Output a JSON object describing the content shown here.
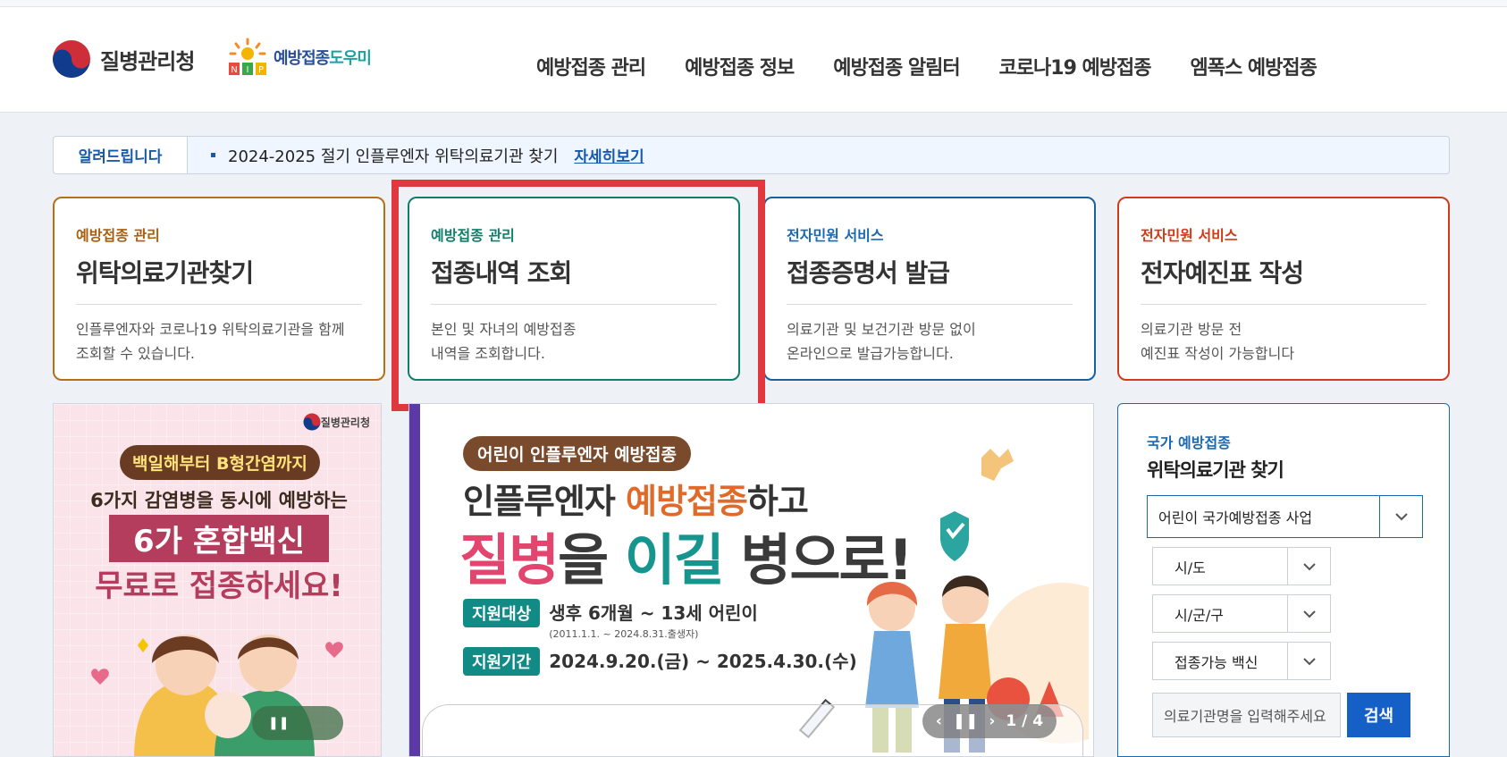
{
  "header": {
    "org_name": "질병관리청",
    "nip_logo_text_a": "예방접종",
    "nip_logo_text_b": "도우미",
    "nav": [
      "예방접종 관리",
      "예방접종 정보",
      "예방접종 알림터",
      "코로나19 예방접종",
      "엠폭스 예방접종"
    ]
  },
  "notice": {
    "tag": "알려드립니다",
    "message": "2024-2025 절기 인플루엔자 위탁의료기관 찾기",
    "more": "자세히보기"
  },
  "cards": [
    {
      "category": "예방접종 관리",
      "title": "위탁의료기관찾기",
      "desc": "인플루엔자와 코로나19 위탁의료기관을 함께\n조회할 수 있습니다."
    },
    {
      "category": "예방접종 관리",
      "title": "접종내역 조회",
      "desc": "본인 및 자녀의 예방접종\n내역을 조회합니다."
    },
    {
      "category": "전자민원 서비스",
      "title": "접종증명서 발급",
      "desc": "의료기관 및 보건기관 방문 없이\n온라인으로 발급가능합니다."
    },
    {
      "category": "전자민원 서비스",
      "title": "전자예진표 작성",
      "desc": "의료기관 방문 전\n예진표 작성이 가능합니다"
    }
  ],
  "banner_left": {
    "logo_text": "질병관리청",
    "pill": "백일해부터 B형간염까지",
    "line1": "6가지 감염병을 동시에 예방하는",
    "line2": "6가 혼합백신",
    "line3": "무료로 접종하세요!"
  },
  "banner_main": {
    "pill": "어린이 인플루엔자 예방접종",
    "head_a": "인플루엔자 ",
    "head_b": "예방접종",
    "head_c": "하고",
    "big_a": "질병",
    "big_b": "을 ",
    "big_c": "이길",
    "big_d": " 병으로!",
    "target_label": "지원대상",
    "target_value": "생후 6개월 ~ 13세 어린이",
    "target_sub": "(2011.1.1. ~ 2024.8.31.출생자)",
    "period_label": "지원기간",
    "period_value": "2024.9.20.(금) ~ 2025.4.30.(수)",
    "pager": "1 / 4"
  },
  "finder": {
    "subtitle": "국가 예방접종",
    "title": "위탁의료기관 찾기",
    "program_select": "어린이 국가예방접종 사업",
    "sido_select": "시/도",
    "sigungu_select": "시/군/구",
    "vaccine_select": "접종가능 백신",
    "search_placeholder": "의료기관명을 입력해주세요",
    "search_button": "검색"
  },
  "colors": {
    "accent_blue": "#1560c7",
    "highlight_red": "#e0383e",
    "card1": "#b86e14",
    "card2": "#0f7f6a",
    "card3": "#1a5f9e",
    "card4": "#d33a1a"
  }
}
